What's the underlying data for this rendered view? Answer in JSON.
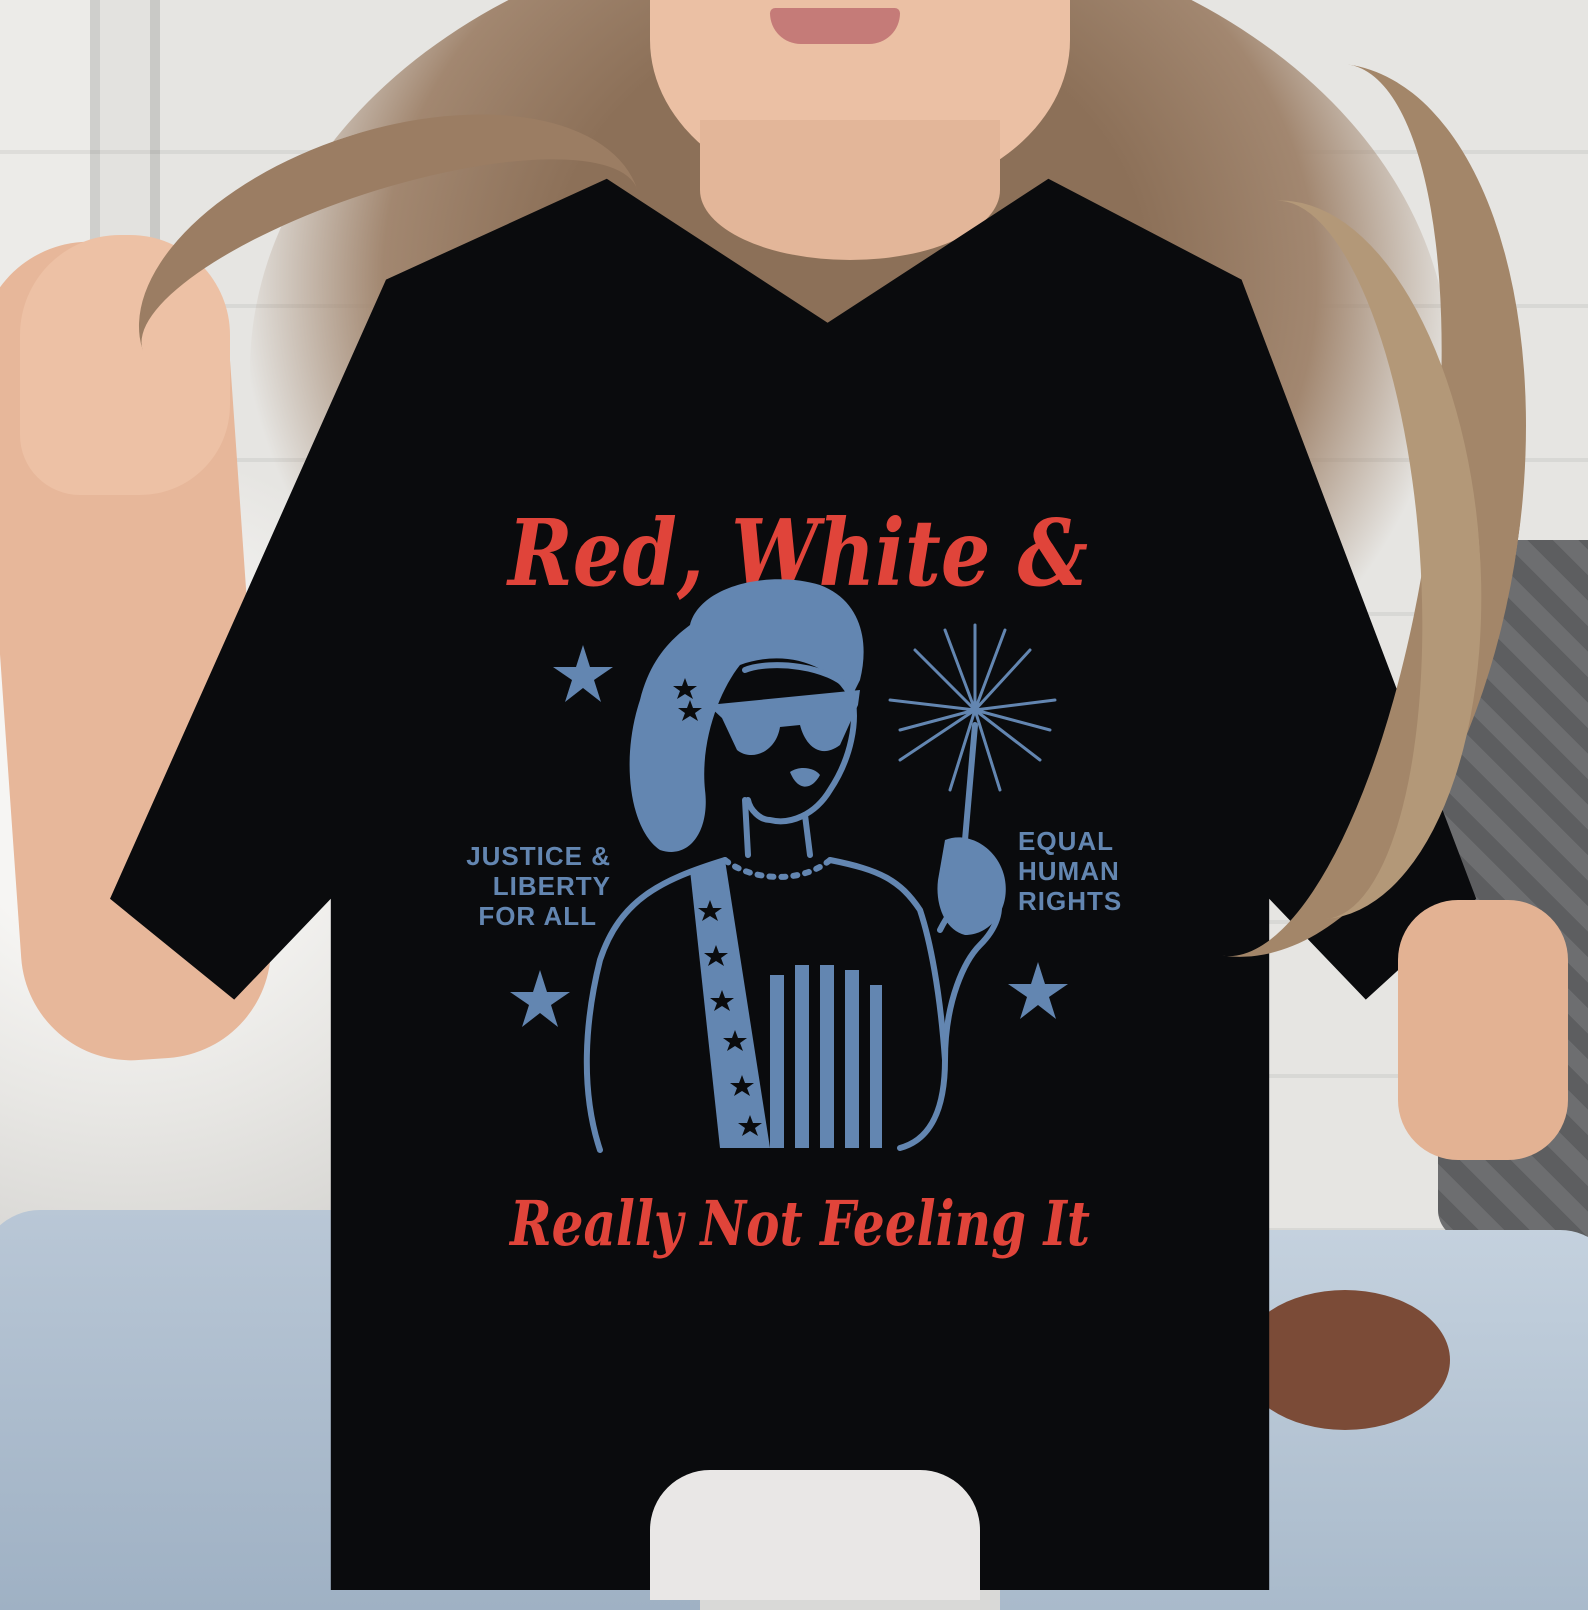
{
  "shirt_print": {
    "headline": "Red, White &",
    "tagline": "Really Not Feeling It",
    "left_slogan": [
      "JUSTICE &",
      "LIBERTY",
      "FOR ALL"
    ],
    "right_slogan": [
      "EQUAL",
      "HUMAN",
      "RIGHTS"
    ]
  },
  "colors": {
    "shirt": "#0a0b0d",
    "script_red": "#e0443a",
    "ink_blue": "#6386b1",
    "jeans": "#b9c7d6"
  },
  "icons": [
    "sparkler-icon",
    "star-icon"
  ]
}
